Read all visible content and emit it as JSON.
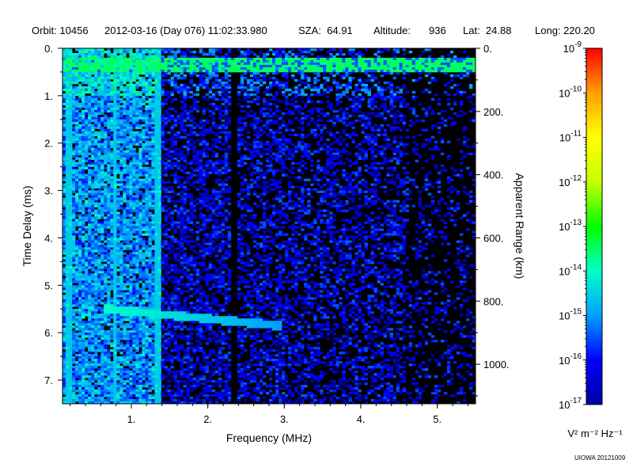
{
  "header": {
    "orbit": "Orbit: 10456",
    "datetime": "2012-03-16 (Day 076) 11:02:33.980",
    "sza": "SZA:  64.91",
    "altitude_label": "Altitude:",
    "altitude_value": "936",
    "lat": "Lat:  24.88",
    "long": "Long: 220.20"
  },
  "credit": "UIOWA 20121009",
  "colors": {
    "background": "#000000",
    "colorbar_stops": [
      "#0000a0",
      "#0000ff",
      "#00a0ff",
      "#00ffc8",
      "#00ff00",
      "#c8ff00",
      "#ffff00",
      "#ffa000",
      "#ff0000"
    ]
  },
  "chart_data": {
    "type": "heatmap",
    "title": "",
    "xlabel": "Frequency (MHz)",
    "ylabel": "Time Delay (ms)",
    "y2label": "Apparent Range (km)",
    "xlim": [
      0.1,
      5.5
    ],
    "ylim": [
      0.0,
      7.5
    ],
    "y2lim": [
      0,
      1125
    ],
    "x_ticks": [
      {
        "value": 1,
        "label": "1."
      },
      {
        "value": 2,
        "label": "2."
      },
      {
        "value": 3,
        "label": "3."
      },
      {
        "value": 4,
        "label": "4."
      },
      {
        "value": 5,
        "label": "5."
      }
    ],
    "y_ticks": [
      {
        "value": 0,
        "label": "0."
      },
      {
        "value": 1,
        "label": "1."
      },
      {
        "value": 2,
        "label": "2."
      },
      {
        "value": 3,
        "label": "3."
      },
      {
        "value": 4,
        "label": "4."
      },
      {
        "value": 5,
        "label": "5."
      },
      {
        "value": 6,
        "label": "6."
      },
      {
        "value": 7,
        "label": "7."
      }
    ],
    "y2_ticks": [
      {
        "value": 0,
        "label": "0."
      },
      {
        "value": 200,
        "label": "200."
      },
      {
        "value": 400,
        "label": "400."
      },
      {
        "value": 600,
        "label": "600."
      },
      {
        "value": 800,
        "label": "800."
      },
      {
        "value": 1000,
        "label": "1000."
      }
    ],
    "colorbar": {
      "scale": "log",
      "min_exp": -17,
      "max_exp": -9,
      "label": "V² m⁻² Hz⁻¹",
      "tick_exps": [
        -9,
        -10,
        -11,
        -12,
        -13,
        -14,
        -15,
        -16,
        -17
      ]
    },
    "features": [
      {
        "name": "surface reflection",
        "delay_ms": 0.35,
        "freq_min_mhz": 0.1,
        "freq_max_mhz": 5.5,
        "log_intensity": -13.5
      },
      {
        "name": "oblique echo trace",
        "delay_ms_start": 5.5,
        "delay_ms_end": 5.85,
        "freq_min_mhz": 0.65,
        "freq_max_mhz": 2.95,
        "log_intensity": -14.0
      }
    ]
  }
}
